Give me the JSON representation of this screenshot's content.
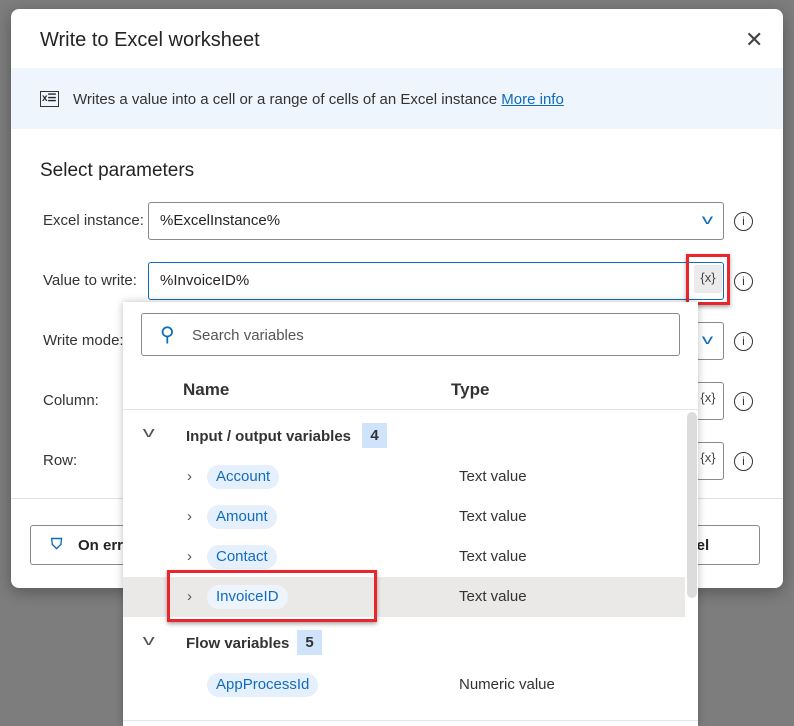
{
  "dialog": {
    "title": "Write to Excel worksheet",
    "description": "Writes a value into a cell or a range of cells of an Excel instance",
    "more_info": "More info",
    "section": "Select parameters"
  },
  "fields": [
    {
      "label": "Excel instance:",
      "value": "%ExcelInstance%"
    },
    {
      "label": "Value to write:",
      "value": "%InvoiceID%",
      "var_button": "{x}"
    },
    {
      "label": "Write mode:"
    },
    {
      "label": "Column:",
      "var_button": "{x}"
    },
    {
      "label": "Row:",
      "var_button": "{x}"
    }
  ],
  "footer": {
    "on_error": "On error",
    "cancel": "Cancel"
  },
  "popup": {
    "search_placeholder": "Search variables",
    "col_name": "Name",
    "col_type": "Type",
    "groups": [
      {
        "label": "Input / output variables",
        "count": "4",
        "items": [
          {
            "name": "Account",
            "type": "Text value"
          },
          {
            "name": "Amount",
            "type": "Text value"
          },
          {
            "name": "Contact",
            "type": "Text value"
          },
          {
            "name": "InvoiceID",
            "type": "Text value",
            "selected": true
          }
        ]
      },
      {
        "label": "Flow variables",
        "count": "5",
        "items": [
          {
            "name": "AppProcessId",
            "type": "Numeric value"
          }
        ]
      }
    ]
  },
  "colors": {
    "accent": "#0f6cbd",
    "highlight": "#e8262c",
    "banner": "#eff5fd"
  }
}
